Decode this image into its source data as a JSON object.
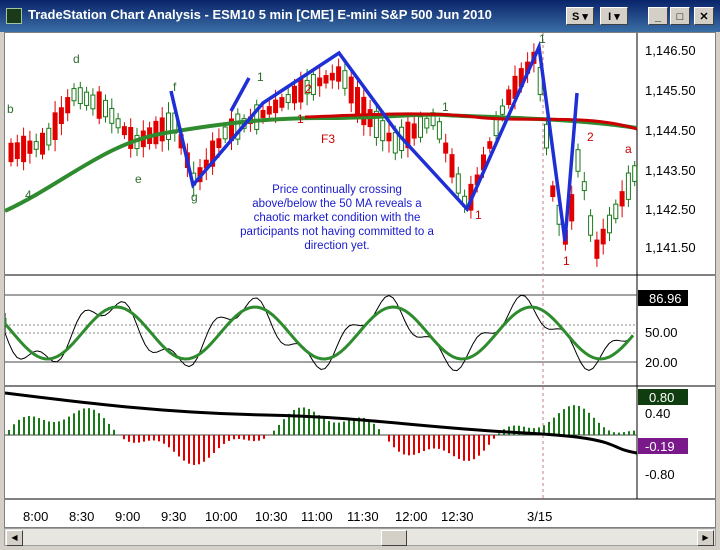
{
  "window": {
    "title": "TradeStation Chart Analysis - ESM10 5 min [CME] E-mini S&P 500 Jun 2010",
    "buttons": {
      "s_menu": "S ▾",
      "i_menu": "I ▾",
      "minimize": "_",
      "maximize": "□",
      "close": "✕"
    }
  },
  "price_axis": [
    "1,146.50",
    "1,145.50",
    "1,144.50",
    "1,143.50",
    "1,142.50",
    "1,141.50"
  ],
  "stoch_axis": {
    "current": "86.96",
    "levels": [
      "50.00",
      "20.00"
    ]
  },
  "macd_axis": {
    "current_up": "0.80",
    "upper": "0.40",
    "current_down": "-0.19",
    "lower": "-0.80"
  },
  "time_axis": [
    "8:00",
    "8:30",
    "9:00",
    "9:30",
    "10:00",
    "10:30",
    "11:00",
    "11:30",
    "12:00",
    "12:30",
    "3/15"
  ],
  "annotation": "Price continually crossing above/below the 50 MA reveals a chaotic market condition with the participants not having committed to a direction yet.",
  "wave_labels": [
    "b",
    "d",
    "f",
    "1",
    "2",
    "1",
    "F3",
    "1",
    "1",
    "1",
    "1",
    "2",
    "a",
    "4",
    "e",
    "g"
  ],
  "colors": {
    "up_bar": "#1a7a1a",
    "down_bar": "#e00000",
    "ma_50": "#cc0000",
    "ma_green": "#2e8b2e",
    "wave_line": "#1f2fd6",
    "note_text": "#1a1acc",
    "axis_bg_up": "#0f3d0f",
    "axis_bg_down": "#7a1a8a"
  }
}
